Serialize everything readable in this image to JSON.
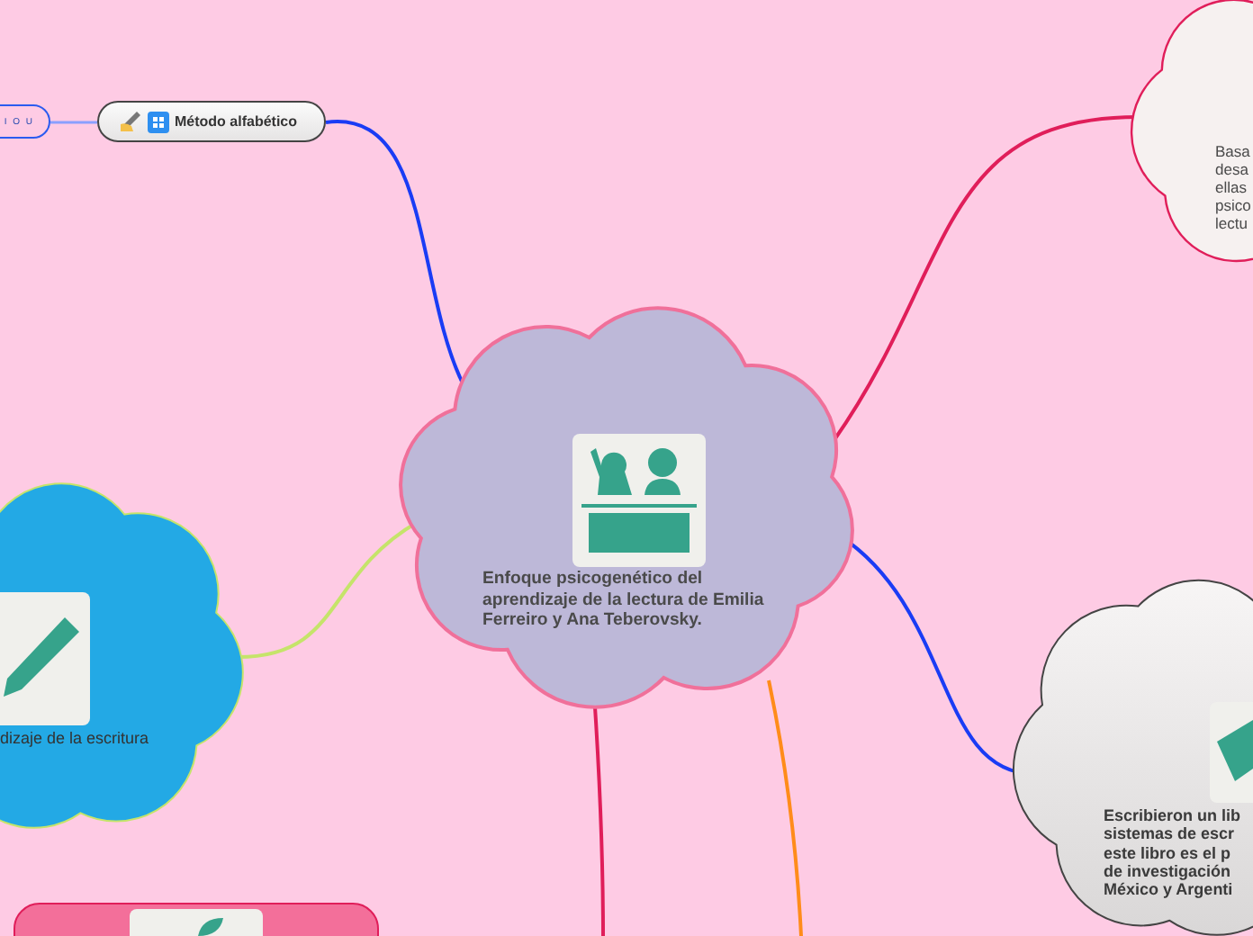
{
  "central_topic": {
    "text": "Enfoque psicogenético del aprendizaje de la lectura de Emilia Ferreiro y Ana Teberovsky."
  },
  "topics": [
    {
      "kind": "tag",
      "text": "I O U"
    },
    {
      "kind": "pill",
      "text": "Método alfabético"
    },
    {
      "kind": "cloud",
      "lines": [
        "Basa",
        "desa",
        "ellas",
        "psico",
        "lectu"
      ]
    },
    {
      "kind": "cloud-gray",
      "lines": [
        "Escribieron un lib",
        "sistemas de escr",
        "este libro es el p",
        "de investigación",
        "México y Argenti"
      ]
    },
    {
      "kind": "cloud-blue",
      "lines": [
        "dizaje de la escritura"
      ]
    },
    {
      "kind": "box"
    }
  ]
}
